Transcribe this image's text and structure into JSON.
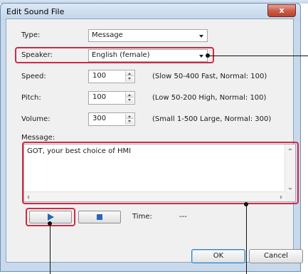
{
  "window": {
    "title": "Edit Sound File",
    "close_label": "x"
  },
  "fields": {
    "type": {
      "label": "Type:",
      "value": "Message"
    },
    "speaker": {
      "label": "Speaker:",
      "value": "English (female)"
    },
    "speed": {
      "label": "Speed:",
      "value": "100",
      "hint": "(Slow 50-400 Fast, Normal: 100)"
    },
    "pitch": {
      "label": "Pitch:",
      "value": "100",
      "hint": "(Low 50-200 High, Normal: 100)"
    },
    "volume": {
      "label": "Volume:",
      "value": "300",
      "hint": "(Small 1-500 Large, Normal: 300)"
    }
  },
  "message": {
    "label": "Message:",
    "text": "GOT, your best choice of HMI"
  },
  "playback": {
    "time_label": "Time:",
    "time_value": "---"
  },
  "buttons": {
    "ok": "OK",
    "cancel": "Cancel"
  },
  "colors": {
    "highlight": "#d02a45",
    "media_icon": "#2a64b8",
    "title_bar": "#c9d9ec"
  }
}
